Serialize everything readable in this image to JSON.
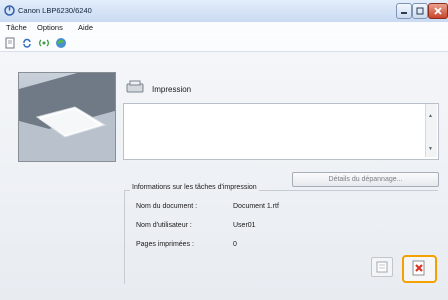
{
  "window": {
    "title": "Canon LBP6230/6240"
  },
  "menu": {
    "items": [
      "Tâche",
      "Options",
      "Aide"
    ]
  },
  "toolbar": {
    "icons": [
      "document-icon",
      "refresh-icon",
      "network-icon",
      "printer-status-icon"
    ]
  },
  "status": {
    "title": "Impression",
    "message": ""
  },
  "buttons": {
    "troubleshooting": "Détails du dépannage..."
  },
  "job_info": {
    "heading": "Informations sur les tâches d'impression",
    "rows": [
      {
        "label": "Nom du document :",
        "value": "Document 1.rtf"
      },
      {
        "label": "Nom d'utilisateur :",
        "value": "User01"
      },
      {
        "label": "Pages imprimées :",
        "value": "0"
      }
    ]
  },
  "colors": {
    "titlebar": "#c9daf2",
    "highlight": "#f2a100",
    "close": "#c7452b"
  }
}
